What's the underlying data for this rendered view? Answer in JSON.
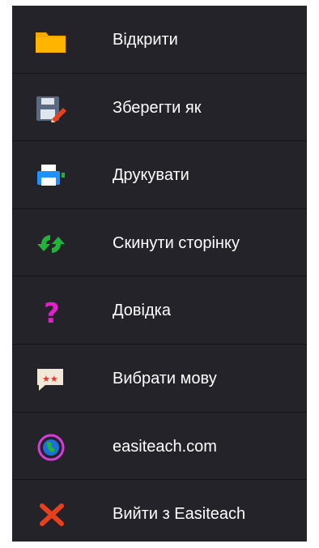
{
  "menu": {
    "items": [
      {
        "label": "Відкрити",
        "icon": "folder-icon"
      },
      {
        "label": "Зберегти як",
        "icon": "save-as-icon"
      },
      {
        "label": "Друкувати",
        "icon": "printer-icon"
      },
      {
        "label": "Скинути сторінку",
        "icon": "reset-page-icon"
      },
      {
        "label": "Довідка",
        "icon": "help-icon"
      },
      {
        "label": "Вибрати мову",
        "icon": "language-icon"
      },
      {
        "label": "easiteach.com",
        "icon": "globe-icon"
      },
      {
        "label": "Вийти з Easiteach",
        "icon": "close-icon"
      }
    ]
  },
  "colors": {
    "menu_background": "#232329",
    "divider": "#141418",
    "text": "#ffffff",
    "folder": "#f5a800",
    "save": "#5a6b80",
    "pencil": "#e8401c",
    "printer": "#1e90ff",
    "reset": "#22b33a",
    "help": "#e020c8",
    "language_bubble": "#f2e8d8",
    "language_stars": "#e3342f",
    "globe_ring": "#d83cd8",
    "globe": "#1e6fd9",
    "close": "#e8401c"
  }
}
